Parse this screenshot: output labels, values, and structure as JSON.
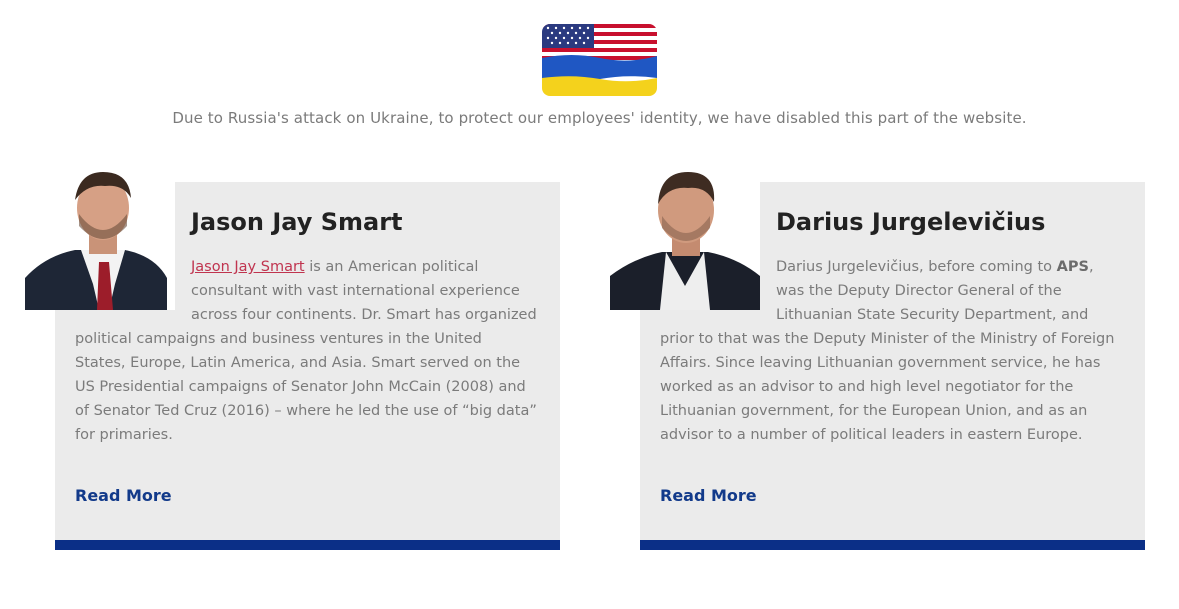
{
  "notice": "Due to Russia's attack on Ukraine, to protect our employees' identity, we have disabled this part of the website.",
  "flag": {
    "icon": "us-ukraine-flag-icon",
    "colors": {
      "us_red": "#c8102e",
      "us_blue": "#2b3a80",
      "ua_blue": "#1f57c3",
      "ua_yellow": "#f4d21c"
    }
  },
  "cards": [
    {
      "name": "Jason Jay Smart",
      "bio_link": "Jason Jay Smart",
      "bio_top": [
        " is an American political",
        "consultant with vast international experience",
        "across four continents. Dr. Smart has organized"
      ],
      "bio_bottom": [
        "political campaigns and business ventures in the United",
        "States, Europe, Latin America, and Asia. Smart served on the",
        "US Presidential campaigns of Senator John McCain (2008) and",
        "of Senator Ted Cruz (2016) – where he led the use of “big data”",
        "for primaries."
      ],
      "read_more": "Read More"
    },
    {
      "name": "Darius Jurgelevičius",
      "bio_top_prefix": "Darius Jurgelevičius, before coming to ",
      "bio_bold": "APS",
      "bio_top_suffix": ",",
      "bio_top": [
        "was the Deputy Director General of the",
        "Lithuanian State Security Department, and"
      ],
      "bio_bottom": [
        "prior to that was the Deputy Minister of the Ministry of Foreign",
        "Affairs. Since leaving Lithuanian government service, he has",
        "worked as an advisor to and high level negotiator for the",
        "Lithuanian government, for the European Union, and as an",
        "advisor to a number of political leaders in eastern Europe."
      ],
      "read_more": "Read More"
    }
  ],
  "colors": {
    "card_bg": "#ebebeb",
    "accent_bar": "#0b2f87",
    "link": "#c0344f",
    "read_more": "#123a8a"
  }
}
